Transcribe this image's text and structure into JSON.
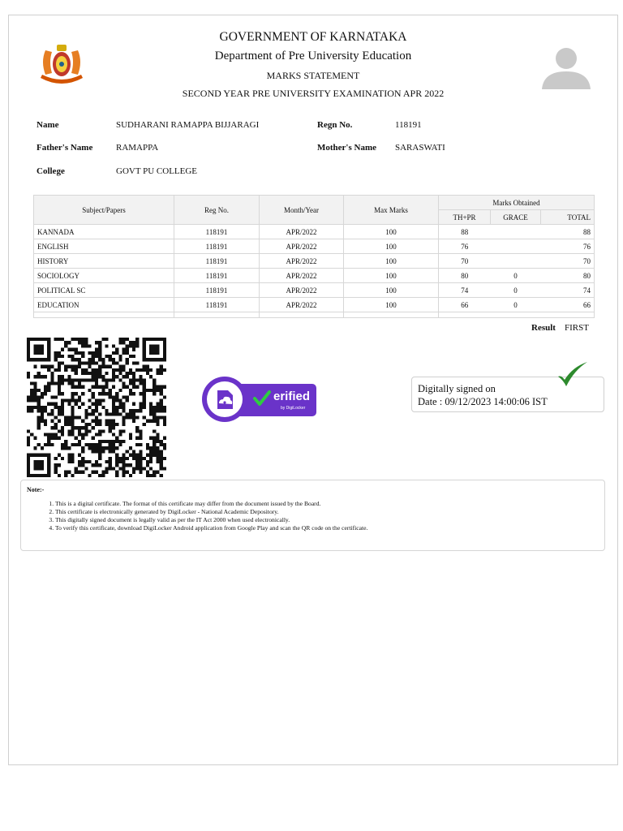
{
  "header": {
    "line1": "GOVERNMENT OF KARNATAKA",
    "line2": "Department of Pre University Education",
    "line3": "MARKS STATEMENT",
    "line4": "SECOND YEAR PRE UNIVERSITY EXAMINATION APR 2022"
  },
  "icons": {
    "emblem": "karnataka-emblem-icon",
    "photo": "person-silhouette-icon",
    "qr": "qr-code-icon",
    "badge": "digilocker-verified-icon",
    "check": "green-check-icon"
  },
  "student": {
    "name_label": "Name",
    "name": "SUDHARANI RAMAPPA BIJJARAGI",
    "regn_label": "Regn No.",
    "regn": "118191",
    "father_label": "Father's Name",
    "father": "RAMAPPA",
    "mother_label": "Mother's Name",
    "mother": "SARASWATI",
    "college_label": "College",
    "college": "GOVT PU COLLEGE"
  },
  "table": {
    "headers": {
      "subject": "Subject/Papers",
      "regno": "Reg No.",
      "month": "Month/Year",
      "max": "Max Marks",
      "obtained": "Marks Obtained",
      "thpr": "TH+PR",
      "grace": "GRACE",
      "total": "TOTAL"
    },
    "rows": [
      {
        "subject": "KANNADA",
        "regno": "118191",
        "month": "APR/2022",
        "max": "100",
        "thpr": "88",
        "grace": "",
        "total": "88"
      },
      {
        "subject": "ENGLISH",
        "regno": "118191",
        "month": "APR/2022",
        "max": "100",
        "thpr": "76",
        "grace": "",
        "total": "76"
      },
      {
        "subject": "HISTORY",
        "regno": "118191",
        "month": "APR/2022",
        "max": "100",
        "thpr": "70",
        "grace": "",
        "total": "70"
      },
      {
        "subject": "SOCIOLOGY",
        "regno": "118191",
        "month": "APR/2022",
        "max": "100",
        "thpr": "80",
        "grace": "0",
        "total": "80"
      },
      {
        "subject": "POLITICAL SC",
        "regno": "118191",
        "month": "APR/2022",
        "max": "100",
        "thpr": "74",
        "grace": "0",
        "total": "74"
      },
      {
        "subject": "EDUCATION",
        "regno": "118191",
        "month": "APR/2022",
        "max": "100",
        "thpr": "66",
        "grace": "0",
        "total": "66"
      }
    ]
  },
  "result": {
    "label": "Result",
    "value": "FIRST"
  },
  "badge": {
    "text": "erified",
    "sub": "by DigiLocker",
    "color": "#6a33c9"
  },
  "signature": {
    "line1": "Digitally signed on",
    "line2": "Date : 09/12/2023 14:00:06 IST"
  },
  "note": {
    "title": "Note:-",
    "items": [
      "This is a digital certificate. The format of this certificate may differ from the document issued by the Board.",
      "This certificate is electronically generated by DigiLocker - National Academic Depository.",
      "This digitally signed document is legally valid as per the IT Act 2000 when used electronically.",
      "To verify this certificate, download DigiLocker Android application from Google Play and scan the QR code on the certificate."
    ]
  }
}
